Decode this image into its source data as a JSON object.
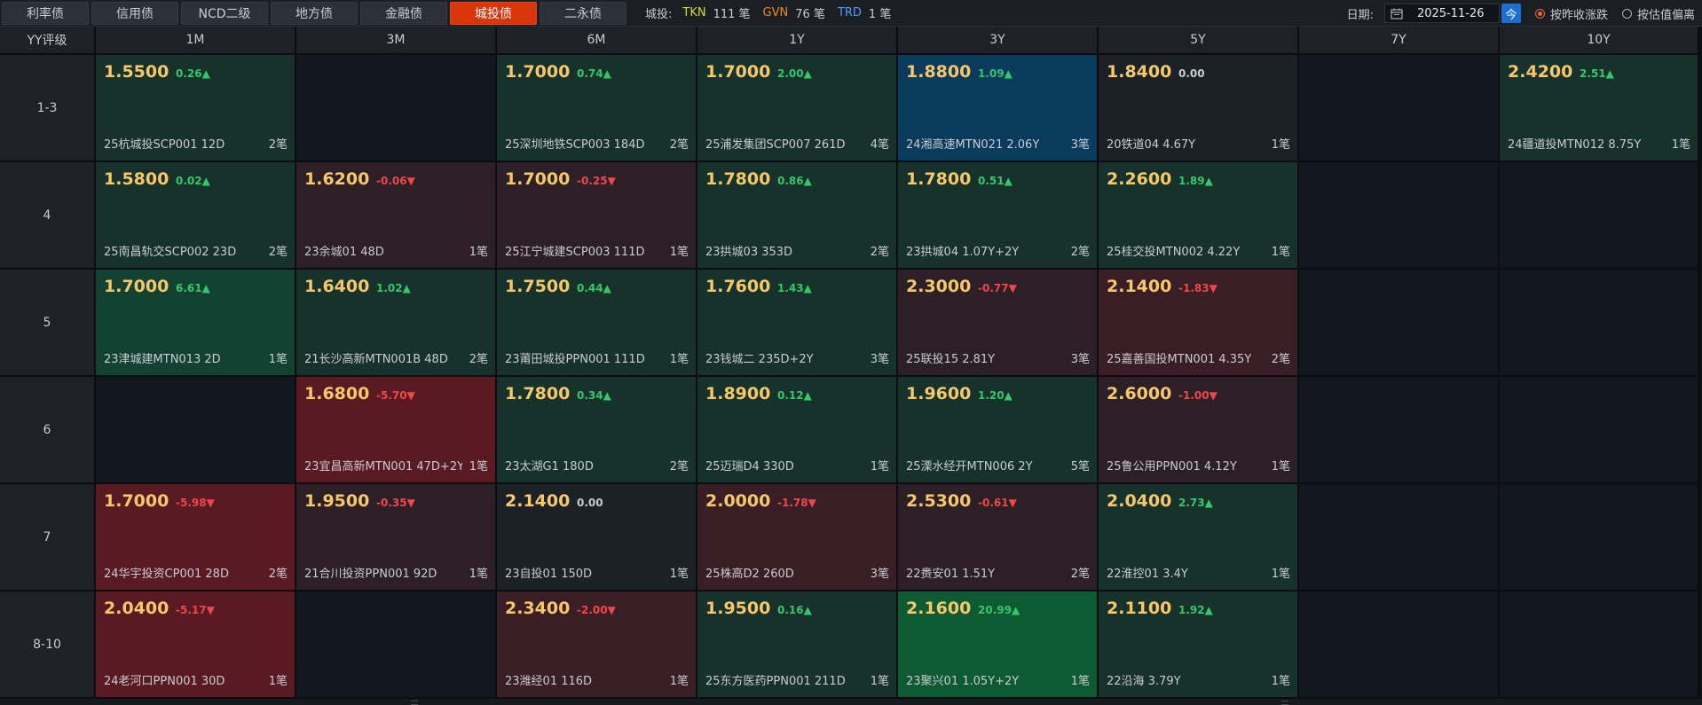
{
  "tabs": [
    {
      "label": "利率债",
      "active": false
    },
    {
      "label": "信用债",
      "active": false
    },
    {
      "label": "NCD二级",
      "active": false
    },
    {
      "label": "地方债",
      "active": false
    },
    {
      "label": "金融债",
      "active": false
    },
    {
      "label": "城投债",
      "active": true
    },
    {
      "label": "二永债",
      "active": false
    }
  ],
  "stats": {
    "label": "城投:",
    "items": [
      {
        "code": "TKN",
        "count": "111 笔",
        "color": "#d3db3c"
      },
      {
        "code": "GVN",
        "count": "76 笔",
        "color": "#ef8a2b"
      },
      {
        "code": "TRD",
        "count": "1 笔",
        "color": "#4aa0ff"
      }
    ]
  },
  "controls": {
    "date_label": "日期:",
    "date_value": "2025-11-26",
    "today_label": "今",
    "radio1": "按昨收涨跌",
    "radio2": "按估值偏离",
    "radio1_checked": true
  },
  "grid": {
    "corner": "YY评级",
    "columns": [
      "1M",
      "3M",
      "6M",
      "1Y",
      "3Y",
      "5Y",
      "7Y",
      "10Y"
    ],
    "rows": [
      {
        "label": "1-3",
        "cells": [
          {
            "y": "1.5500",
            "c": "0.26▲",
            "d": "up",
            "b": "25杭城投SCP001 12D",
            "n": "2笔",
            "bg": "#17312b"
          },
          null,
          {
            "y": "1.7000",
            "c": "0.74▲",
            "d": "up",
            "b": "25深圳地铁SCP003 184D",
            "n": "2笔",
            "bg": "#17312b"
          },
          {
            "y": "1.7000",
            "c": "2.00▲",
            "d": "up",
            "b": "25浦发集团SCP007 261D",
            "n": "4笔",
            "bg": "#17312b"
          },
          {
            "y": "1.8800",
            "c": "1.09▲",
            "d": "up",
            "b": "24湘高速MTN021 2.06Y",
            "n": "3笔",
            "bg": "#0a3a5c"
          },
          {
            "y": "1.8400",
            "c": "0.00",
            "d": "flat",
            "b": "20铁道04 4.67Y",
            "n": "1笔",
            "bg": "#1c2128"
          },
          null,
          {
            "y": "2.4200",
            "c": "2.51▲",
            "d": "up",
            "b": "24疆道投MTN012 8.75Y",
            "n": "1笔",
            "bg": "#17312b"
          }
        ]
      },
      {
        "label": "4",
        "cells": [
          {
            "y": "1.5800",
            "c": "0.02▲",
            "d": "up",
            "b": "25南昌轨交SCP002 23D",
            "n": "2笔",
            "bg": "#17312b"
          },
          {
            "y": "1.6200",
            "c": "-0.06▼",
            "d": "down",
            "b": "23余城01 48D",
            "n": "1笔",
            "bg": "#2c1f26"
          },
          {
            "y": "1.7000",
            "c": "-0.25▼",
            "d": "down",
            "b": "25江宁城建SCP003 111D",
            "n": "1笔",
            "bg": "#2c1f26"
          },
          {
            "y": "1.7800",
            "c": "0.86▲",
            "d": "up",
            "b": "23拱城03 353D",
            "n": "2笔",
            "bg": "#17312b"
          },
          {
            "y": "1.7800",
            "c": "0.51▲",
            "d": "up",
            "b": "23拱城04 1.07Y+2Y",
            "n": "2笔",
            "bg": "#17312b"
          },
          {
            "y": "2.2600",
            "c": "1.89▲",
            "d": "up",
            "b": "25桂交投MTN002 4.22Y",
            "n": "1笔",
            "bg": "#17312b"
          },
          null,
          null
        ]
      },
      {
        "label": "5",
        "cells": [
          {
            "y": "1.7000",
            "c": "6.61▲",
            "d": "up",
            "b": "23津城建MTN013 2D",
            "n": "1笔",
            "bg": "#134233"
          },
          {
            "y": "1.6400",
            "c": "1.02▲",
            "d": "up",
            "b": "21长沙高新MTN001B 48D",
            "n": "2笔",
            "bg": "#17312b"
          },
          {
            "y": "1.7500",
            "c": "0.44▲",
            "d": "up",
            "b": "23莆田城投PPN001 111D",
            "n": "1笔",
            "bg": "#17312b"
          },
          {
            "y": "1.7600",
            "c": "1.43▲",
            "d": "up",
            "b": "23钱城二 235D+2Y",
            "n": "3笔",
            "bg": "#17312b"
          },
          {
            "y": "2.3000",
            "c": "-0.77▼",
            "d": "down",
            "b": "25联投15 2.81Y",
            "n": "3笔",
            "bg": "#2c1f26"
          },
          {
            "y": "2.1400",
            "c": "-1.83▼",
            "d": "down",
            "b": "25嘉善国投MTN001 4.35Y",
            "n": "2笔",
            "bg": "#3a1e25"
          },
          null,
          null
        ]
      },
      {
        "label": "6",
        "cells": [
          null,
          {
            "y": "1.6800",
            "c": "-5.70▼",
            "d": "down",
            "b": "23宜昌高新MTN001 47D+2Y",
            "n": "1笔",
            "bg": "#5a1a22"
          },
          {
            "y": "1.7800",
            "c": "0.34▲",
            "d": "up",
            "b": "23太湖G1 180D",
            "n": "2笔",
            "bg": "#17312b"
          },
          {
            "y": "1.8900",
            "c": "0.12▲",
            "d": "up",
            "b": "25迈瑞D4 330D",
            "n": "1笔",
            "bg": "#17312b"
          },
          {
            "y": "1.9600",
            "c": "1.20▲",
            "d": "up",
            "b": "25溧水经开MTN006 2Y",
            "n": "5笔",
            "bg": "#17312b"
          },
          {
            "y": "2.6000",
            "c": "-1.00▼",
            "d": "down",
            "b": "25鲁公用PPN001 4.12Y",
            "n": "1笔",
            "bg": "#2c1f26"
          },
          null,
          null
        ]
      },
      {
        "label": "7",
        "cells": [
          {
            "y": "1.7000",
            "c": "-5.98▼",
            "d": "down",
            "b": "24华宇投资CP001 28D",
            "n": "2笔",
            "bg": "#5a1a22"
          },
          {
            "y": "1.9500",
            "c": "-0.35▼",
            "d": "down",
            "b": "21合川投资PPN001 92D",
            "n": "1笔",
            "bg": "#2c1f26"
          },
          {
            "y": "2.1400",
            "c": "0.00",
            "d": "flat",
            "b": "23自投01 150D",
            "n": "1笔",
            "bg": "#1c2128"
          },
          {
            "y": "2.0000",
            "c": "-1.78▼",
            "d": "down",
            "b": "25株高D2 260D",
            "n": "3笔",
            "bg": "#3a1e25"
          },
          {
            "y": "2.5300",
            "c": "-0.61▼",
            "d": "down",
            "b": "22赉安01 1.51Y",
            "n": "2笔",
            "bg": "#2c1f26"
          },
          {
            "y": "2.0400",
            "c": "2.73▲",
            "d": "up",
            "b": "22淮控01 3.4Y",
            "n": "1笔",
            "bg": "#17312b"
          },
          null,
          null
        ]
      },
      {
        "label": "8-10",
        "cells": [
          {
            "y": "2.0400",
            "c": "-5.17▼",
            "d": "down",
            "b": "24老河口PPN001 30D",
            "n": "1笔",
            "bg": "#5a1a22"
          },
          null,
          {
            "y": "2.3400",
            "c": "-2.00▼",
            "d": "down",
            "b": "23潍经01 116D",
            "n": "1笔",
            "bg": "#3a1e25"
          },
          {
            "y": "1.9500",
            "c": "0.16▲",
            "d": "up",
            "b": "25东方医药PPN001 211D",
            "n": "1笔",
            "bg": "#17312b"
          },
          {
            "y": "2.1600",
            "c": "20.99▲",
            "d": "up",
            "b": "23聚兴01 1.05Y+2Y",
            "n": "1笔",
            "bg": "#0e5a32"
          },
          {
            "y": "2.1100",
            "c": "1.92▲",
            "d": "up",
            "b": "22沿海 3.79Y",
            "n": "1笔",
            "bg": "#17312b"
          },
          null,
          null
        ]
      }
    ]
  },
  "colors": {
    "empty_cell": "#131820",
    "accent_tab": "#d9360d",
    "up": "#35c86a",
    "down": "#f0474c",
    "yield": "#f6c86a"
  }
}
